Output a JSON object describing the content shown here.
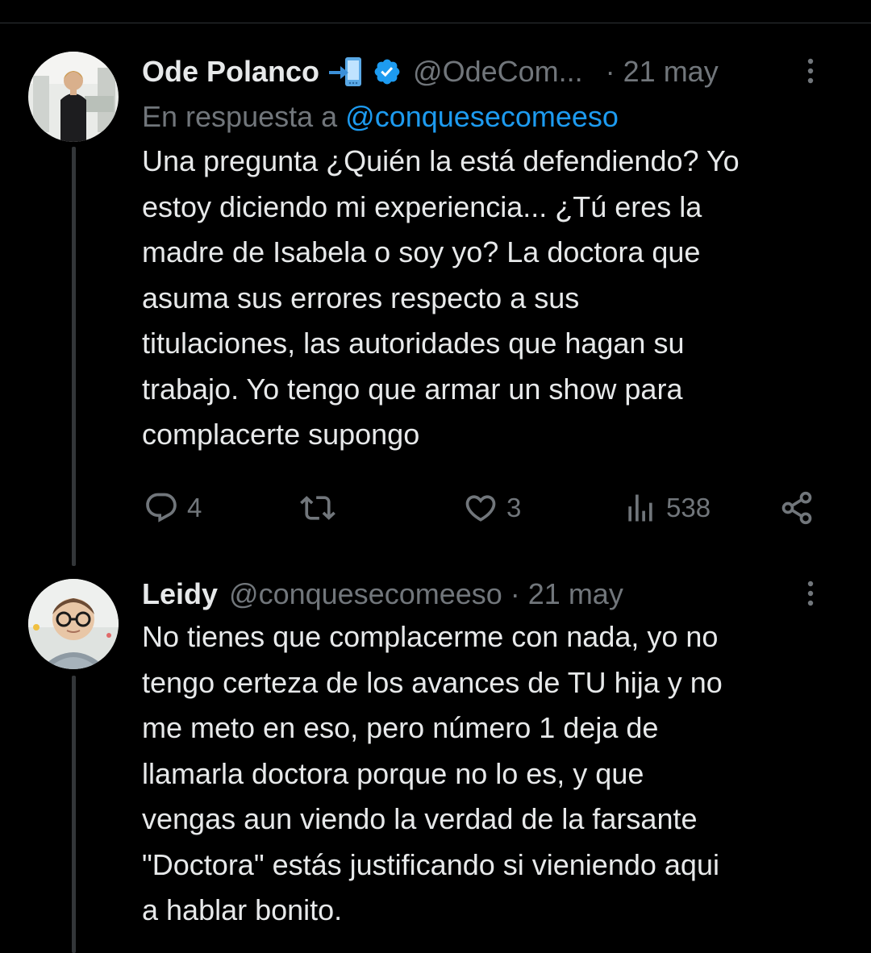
{
  "tweets": [
    {
      "display_name": "Ode Polanco",
      "badge_emoji": "mobile-phone-arrow-emoji",
      "verified": true,
      "handle": "@OdeCom...",
      "time": "· 21 may",
      "reply_prefix": "En respuesta a",
      "reply_mention": "@conquesecomeeso",
      "text": "Una pregunta ¿Quién la está defendiendo? Yo\nestoy diciendo mi experiencia... ¿Tú eres la\nmadre de Isabela o soy yo? La doctora que\nasuma sus errores respecto a sus\ntitulaciones, las autoridades que hagan su\ntrabajo. Yo tengo que armar un show para\ncomplacerte supongo",
      "stats": {
        "replies": "4",
        "retweets": "",
        "likes": "3",
        "views": "538"
      }
    },
    {
      "display_name": "Leidy",
      "handle": "@conquesecomeeso",
      "time": "· 21 may",
      "text": "No tienes que complacerme con nada, yo no\ntengo certeza de los avances de TU hija y no\nme meto en eso, pero número 1 deja de\nllamarla doctora porque no lo es, y que\nvengas aun viendo la verdad de la farsante\n\"Doctora\" estás justificando si vieniendo aqui\na hablar bonito."
    }
  ],
  "colors": {
    "background": "#000000",
    "text": "#e7e9ea",
    "secondary": "#71767b",
    "link": "#1d9bf0",
    "thread_line": "#333639"
  },
  "icons": [
    "reply-icon",
    "retweet-icon",
    "like-icon",
    "views-icon",
    "share-icon",
    "more-icon",
    "verified-icon"
  ]
}
